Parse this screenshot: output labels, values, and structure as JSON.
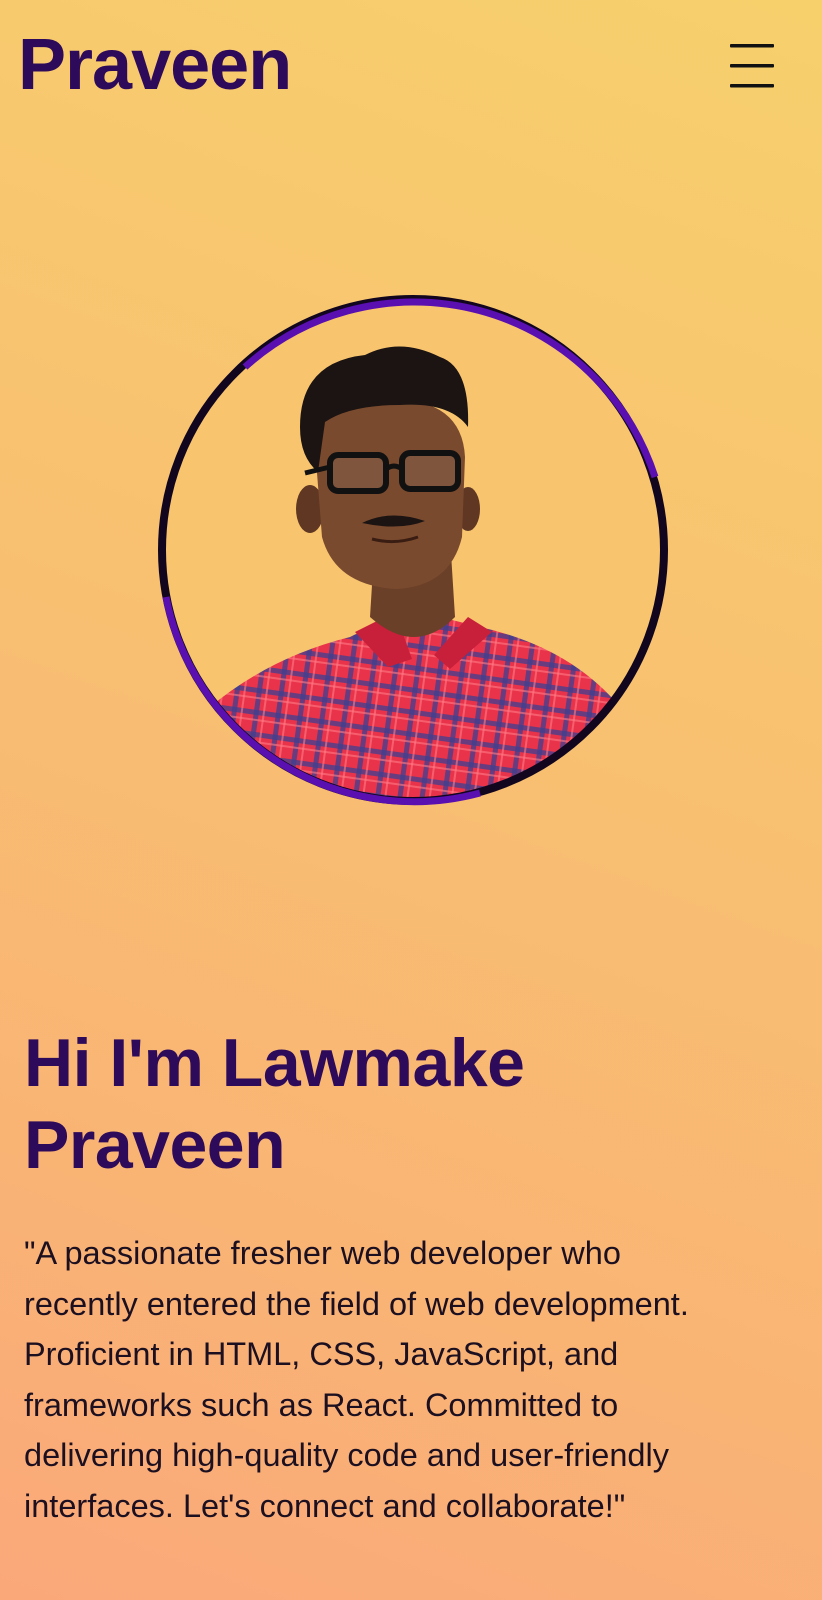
{
  "header": {
    "brand": "Praveen",
    "menu_icon": "hamburger-menu-icon"
  },
  "hero": {
    "avatar_icon": "profile-photo",
    "title_lines": [
      "Hi I'm Lawmake",
      "Praveen"
    ],
    "bio_lines": [
      "\"A passionate fresher web developer who",
      "recently entered the field of web development.",
      "Proficient in HTML, CSS, JavaScript, and",
      "frameworks such as React. Committed to",
      "delivering high-quality code and user-friendly",
      "interfaces. Let's connect and collaborate!\""
    ]
  },
  "colors": {
    "brand_text": "#2e0a5a",
    "ring_purple": "#5a0fb0",
    "ring_dark": "#12061f",
    "background_top": "#f7d06c",
    "background_bottom": "#faa87a"
  }
}
